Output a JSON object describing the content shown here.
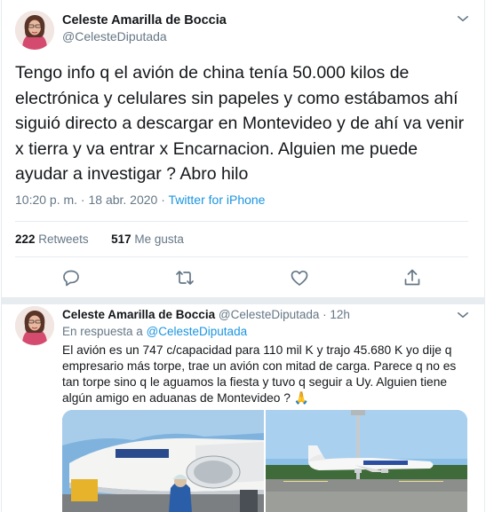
{
  "main_tweet": {
    "author_name": "Celeste Amarilla de Boccia",
    "author_handle": "@CelesteDiputada",
    "text": "Tengo info q el avión de china tenía  50.000 kilos de electrónica y celulares sin papeles y como estábamos ahí siguió directo a descargar en Montevideo y de ahí va venir x tierra y va entrar x Encarnacion. Alguien me puede ayudar a investigar ? Abro hilo",
    "timestamp": "10:20 p. m. · 18 abr. 2020 · ",
    "source": "Twitter for iPhone",
    "retweet_count": "222",
    "retweet_label": "Retweets",
    "like_count": "517",
    "like_label": "Me gusta",
    "actions": [
      "reply-icon",
      "retweet-icon",
      "like-icon",
      "share-icon"
    ]
  },
  "reply_tweet": {
    "author_name": "Celeste Amarilla de Boccia",
    "author_handle": "@CelesteDiputada",
    "time": "· 12h",
    "in_reply_prefix": "En respuesta a ",
    "in_reply_handle": "@CelesteDiputada",
    "text": "El avión es un 747 c/capacidad para 110 mil K y trajo 45.680 K yo dije q empresario más torpe, trae un avión con mitad de carga. Parece q no es tan torpe sino q le aguamos la fiesta y tuvo q seguir a Uy. Alguien tiene algún amigo en aduanas de Montevideo ? 🙏"
  },
  "colors": {
    "link": "#1b95e0",
    "muted": "#657786",
    "text": "#14171a",
    "border": "#e6ecf0"
  }
}
